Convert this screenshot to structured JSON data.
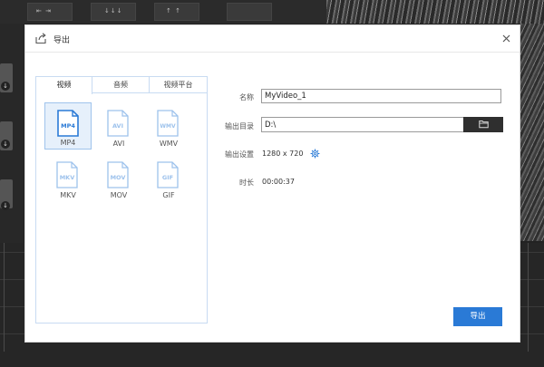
{
  "dialog": {
    "title": "导出",
    "close_icon": "close-icon",
    "export_button": "导出"
  },
  "tabs": [
    {
      "label": "视频",
      "active": true
    },
    {
      "label": "音频",
      "active": false
    },
    {
      "label": "视频平台",
      "active": false
    }
  ],
  "formats": [
    {
      "name": "MP4",
      "badge": "MP4",
      "selected": true
    },
    {
      "name": "AVI",
      "badge": "AVI",
      "selected": false
    },
    {
      "name": "WMV",
      "badge": "WMV",
      "selected": false
    },
    {
      "name": "MKV",
      "badge": "MKV",
      "selected": false
    },
    {
      "name": "MOV",
      "badge": "MOV",
      "selected": false
    },
    {
      "name": "GIF",
      "badge": "GIF",
      "selected": false
    }
  ],
  "form": {
    "name_label": "名称",
    "name_value": "MyVideo_1",
    "output_dir_label": "输出目录",
    "output_dir_value": "D:\\",
    "output_settings_label": "输出设置",
    "resolution": "1280 x 720",
    "duration_label": "时长",
    "duration": "00:00:37"
  },
  "colors": {
    "accent": "#2a7ad6",
    "selected_bg": "#e6f0fb",
    "icon_blue": "#2a7ad6",
    "icon_light": "#9dc2ec"
  }
}
